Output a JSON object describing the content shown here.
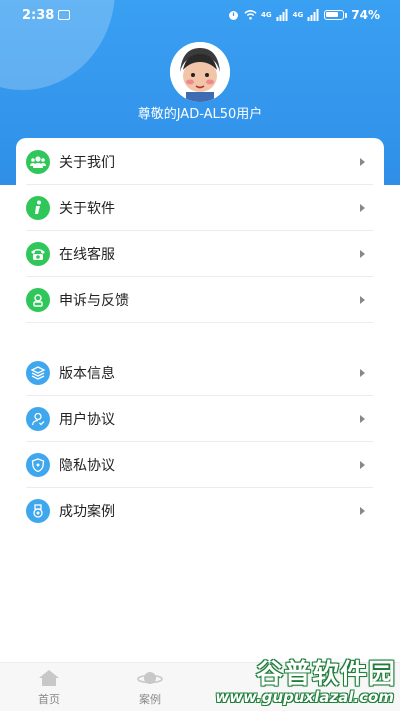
{
  "status_bar": {
    "time": "2:38",
    "network1": "4G",
    "network2": "4G",
    "battery": "74%"
  },
  "profile": {
    "username": "尊敬的JAD-AL50用户"
  },
  "menu": {
    "group1": [
      {
        "label": "关于我们",
        "icon": "people-icon",
        "color": "#2fc65a"
      },
      {
        "label": "关于软件",
        "icon": "info-icon",
        "color": "#2fc65a"
      },
      {
        "label": "在线客服",
        "icon": "phone-icon",
        "color": "#2fc65a"
      },
      {
        "label": "申诉与反馈",
        "icon": "feedback-icon",
        "color": "#2fc65a"
      }
    ],
    "group2": [
      {
        "label": "版本信息",
        "icon": "layers-icon",
        "color": "#3fa7ee"
      },
      {
        "label": "用户协议",
        "icon": "user-agreement-icon",
        "color": "#3fa7ee"
      },
      {
        "label": "隐私协议",
        "icon": "shield-icon",
        "color": "#3fa7ee"
      },
      {
        "label": "成功案例",
        "icon": "medal-icon",
        "color": "#3fa7ee"
      }
    ]
  },
  "tabbar": {
    "tabs": [
      {
        "label": "首页",
        "icon": "home-icon"
      },
      {
        "label": "案例",
        "icon": "planet-icon"
      }
    ]
  },
  "watermark": {
    "title": "谷普软件园",
    "url": "www.gupuxlazal.com"
  },
  "colors": {
    "header_blue": "#2f8fe8",
    "accent_green": "#2fc65a",
    "accent_blue": "#3fa7ee"
  }
}
